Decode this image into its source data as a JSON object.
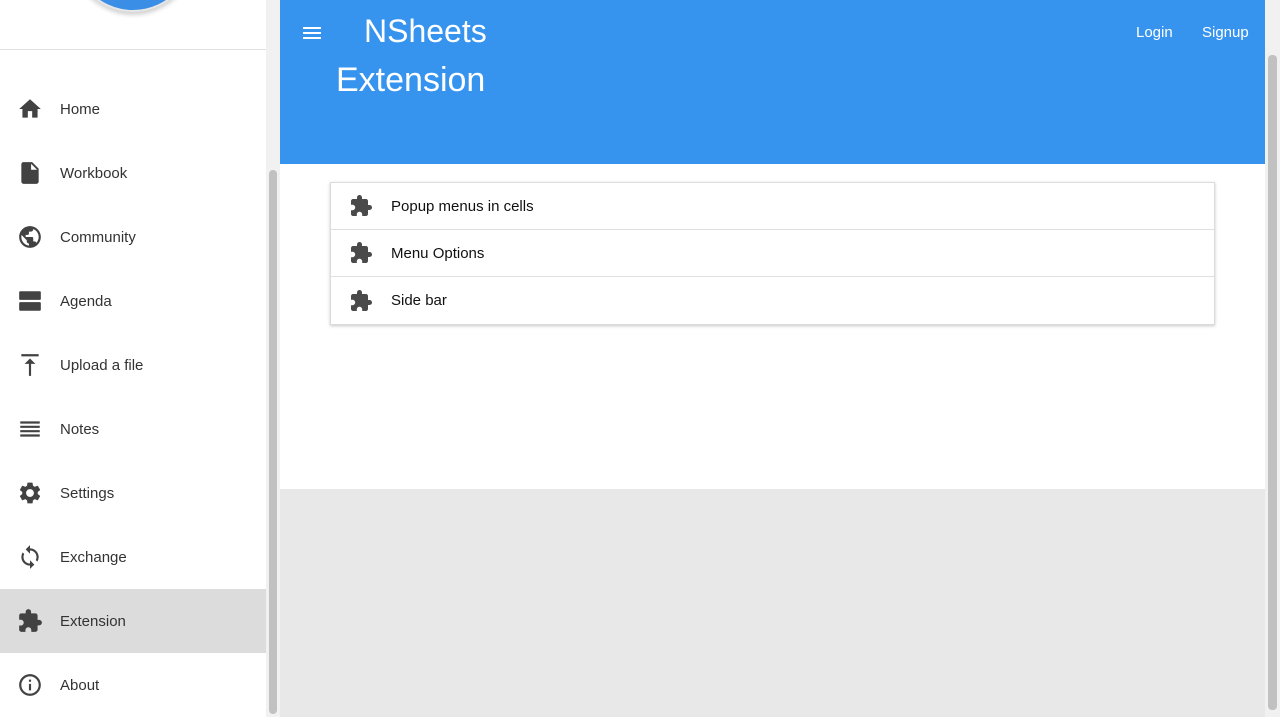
{
  "app": {
    "title": "NSheets",
    "page_title": "Extension"
  },
  "header": {
    "login_label": "Login",
    "signup_label": "Signup"
  },
  "sidebar": {
    "items": [
      {
        "label": "Home",
        "icon": "home-icon"
      },
      {
        "label": "Workbook",
        "icon": "file-icon"
      },
      {
        "label": "Community",
        "icon": "globe-icon"
      },
      {
        "label": "Agenda",
        "icon": "agenda-icon"
      },
      {
        "label": "Upload a file",
        "icon": "upload-icon"
      },
      {
        "label": "Notes",
        "icon": "notes-icon"
      },
      {
        "label": "Settings",
        "icon": "gear-icon"
      },
      {
        "label": "Exchange",
        "icon": "sync-icon"
      },
      {
        "label": "Extension",
        "icon": "extension-icon",
        "active": true
      },
      {
        "label": "About",
        "icon": "info-icon"
      }
    ]
  },
  "extensions": {
    "items": [
      {
        "label": "Popup menus in cells",
        "icon": "extension-icon"
      },
      {
        "label": "Menu Options",
        "icon": "extension-icon"
      },
      {
        "label": "Side bar",
        "icon": "extension-icon"
      }
    ]
  },
  "colors": {
    "appbar": "#3694ee",
    "active_item": "#dcdcdc"
  }
}
